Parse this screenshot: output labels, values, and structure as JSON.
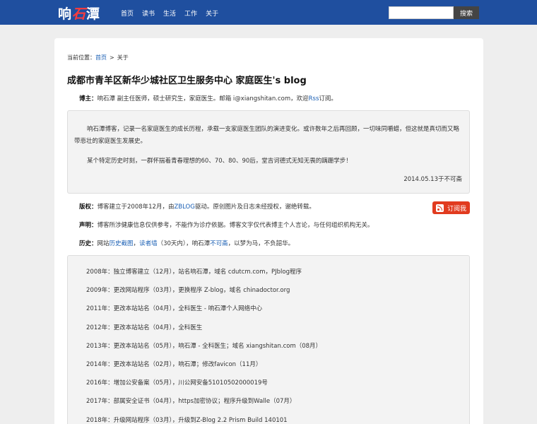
{
  "header": {
    "logo_left": "响",
    "logo_mid": "石",
    "logo_right": "潭",
    "nav": [
      "首页",
      "读书",
      "生活",
      "工作",
      "关于"
    ],
    "search_placeholder": "",
    "search_button": "搜索"
  },
  "breadcrumb": {
    "prefix": "当前位置：",
    "home": "首页",
    "sep": ">",
    "current": "关于"
  },
  "page_title": "成都市青羊区新华少城社区卫生服务中心 家庭医生's blog",
  "owner": {
    "label": "博主：",
    "text_before": "响石潭 副主任医师，硕士研究生，家庭医生。邮箱 i@xiangshitan.com，欢迎",
    "rss_link": "Rss",
    "text_after": "订阅。"
  },
  "intro": {
    "p1": "响石潭博客，记录一名家庭医生的成长历程，承载一支家庭医生团队的演进变化。或许数年之后再回顾，一切味同嚼蜡，但这就是真切而又略带悲壮的家庭医生发展史。",
    "p2": "某个特定历史时刻，一群怀揣着青春理想的60、70、80、90后，堂吉诃德式无知无畏的蹒跚学步！",
    "signature": "2014.05.13于不可斋"
  },
  "copyright": {
    "label": "版权：",
    "text_before": "博客建立于2008年12月，由",
    "link": "ZBLOG",
    "text_after": "驱动。原创图片及日志未经授权，谢绝转载。"
  },
  "statement": {
    "label": "声明：",
    "text": "博客所涉健康信息仅供参考，不能作为诊疗依据。博客文字仅代表博主个人言论，与任何组织机构无关。"
  },
  "history": {
    "label": "历史：",
    "text1": "网站",
    "link1": "历史截图",
    "comma": "，",
    "link2": "读者墙",
    "text2": "（30天内），响石潭",
    "link3": "不可斋",
    "text3": "，以梦为马，不负韶华。"
  },
  "subscribe_button": "订阅我",
  "timeline": [
    "2008年：独立博客建立（12月），站名响石潭，域名 cdutcm.com，PJblog程序",
    "2009年：更改网站程序（03月），更换程序 Z-blog，域名 chinadoctor.org",
    "2011年：更改本站站名（04月），全科医生 - 响石潭个人网络中心",
    "2012年：更改本站站名（04月），全科医生",
    "2013年：更改本站站名（05月），响石潭 - 全科医生；域名 xiangshitan.com（08月）",
    "2014年：更改本站站名（02月），响石潭；修改favicon（11月）",
    "2016年：增加公安备案（05月），川公网安备51010502000019号",
    "2017年：部属安全证书（04月），https加密协议；程序升级到Walle（07月）",
    "2018年：升级网站程序（03月），升级到Z-Blog 2.2 Prism Build 140101"
  ]
}
